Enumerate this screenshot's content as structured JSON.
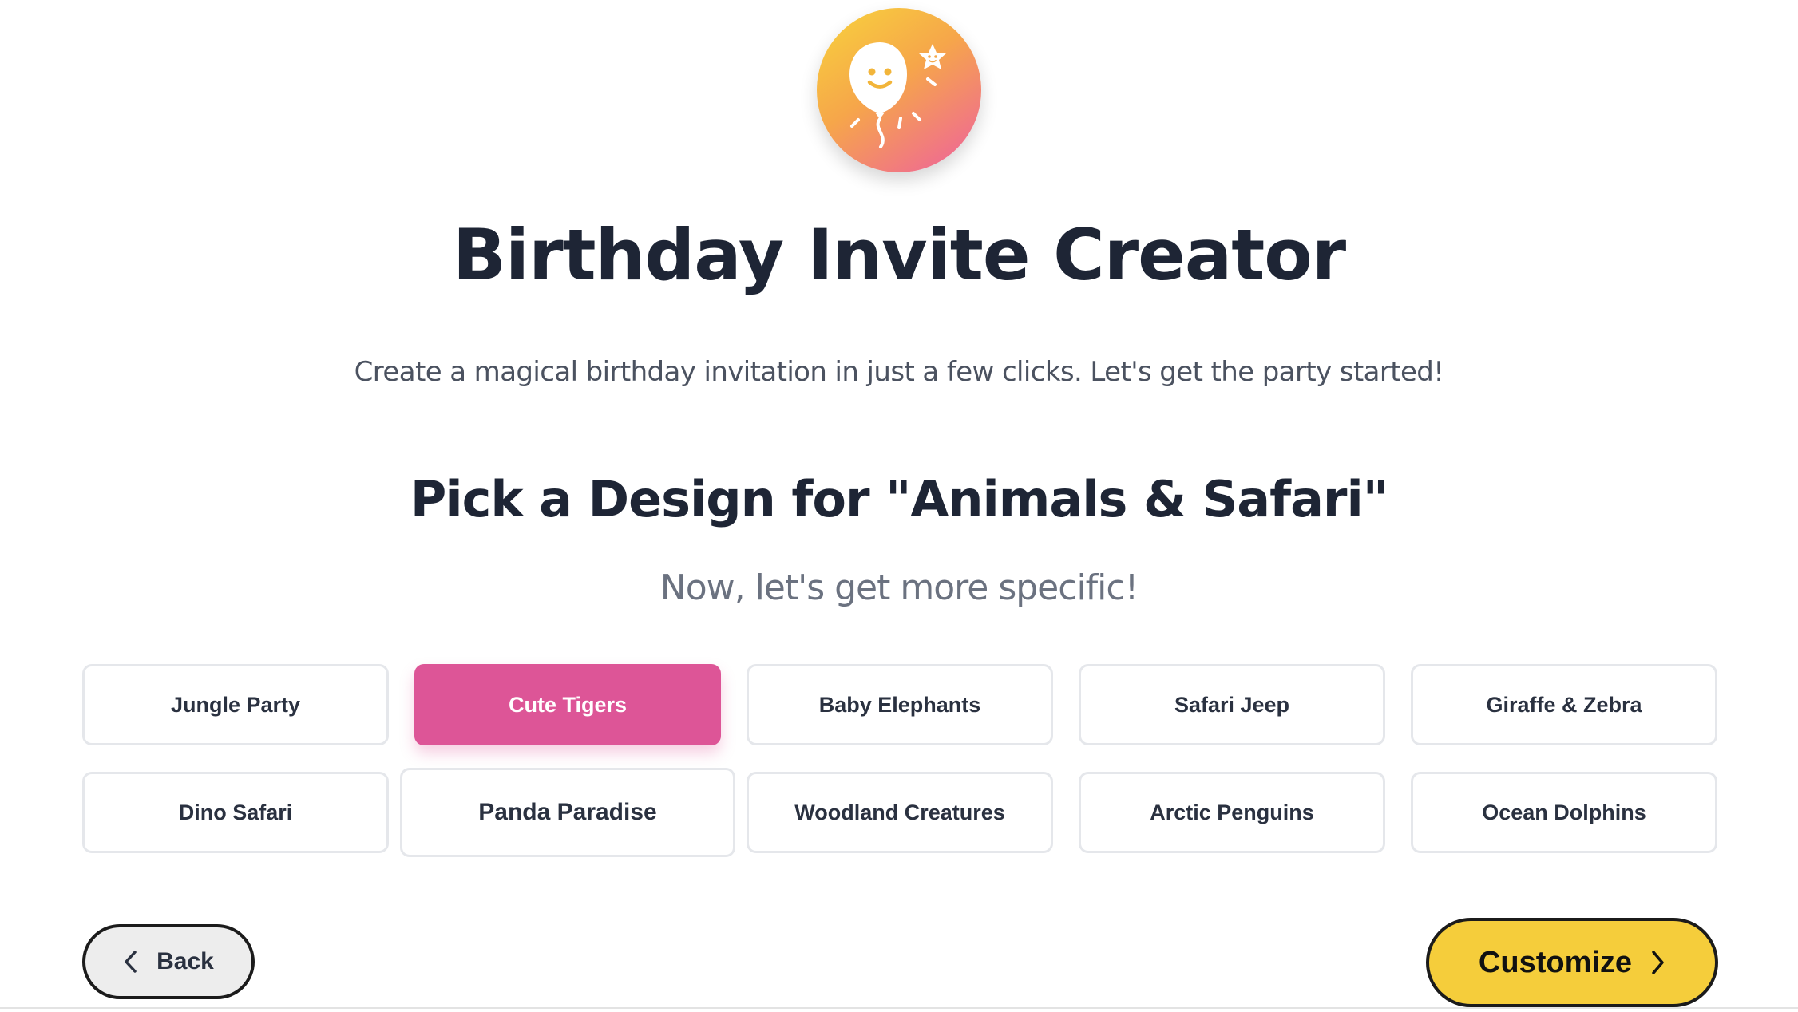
{
  "app": {
    "title": "Birthday Invite Creator",
    "subtitle": "Create a magical birthday invitation in just a few clicks. Let's get the party started!",
    "logo_icon": "smiling-balloon-icon"
  },
  "step": {
    "title": "Pick a Design for \"Animals & Safari\"",
    "subtitle": "Now, let's get more specific!",
    "selected": "Cute Tigers",
    "options": [
      "Jungle Party",
      "Cute Tigers",
      "Baby Elephants",
      "Safari Jeep",
      "Giraffe & Zebra",
      "Dino Safari",
      "Panda Paradise",
      "Woodland Creatures",
      "Arctic Penguins",
      "Ocean Dolphins"
    ]
  },
  "nav": {
    "back_label": "Back",
    "back_icon": "chevron-left-icon",
    "customize_label": "Customize",
    "customize_icon": "chevron-right-icon"
  },
  "colors": {
    "selected_bg": "#dd5597",
    "primary_button_bg": "#f5cd3b",
    "back_button_bg": "#ededed",
    "heading_text": "#1e2535"
  }
}
